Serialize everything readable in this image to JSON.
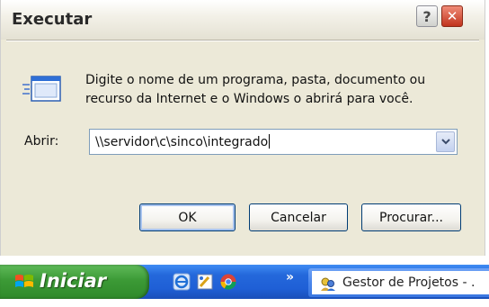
{
  "dialog": {
    "title": "Executar",
    "help_glyph": "?",
    "close_glyph": "✕",
    "description": "Digite o nome de um programa, pasta, documento ou recurso da Internet e o Windows o abrirá para você.",
    "open_label": "Abrir:",
    "open_value": "\\\\servidor\\c\\sinco\\integrado",
    "buttons": {
      "ok": "OK",
      "cancel": "Cancelar",
      "browse": "Procurar..."
    }
  },
  "taskbar": {
    "start_label": "Iniciar",
    "chevron": "»",
    "quick_launch": [
      "internet-explorer-icon",
      "paint-icon",
      "chrome-icon"
    ],
    "task_button_label": "Gestor de Projetos - ."
  },
  "colors": {
    "taskbar_blue": "#2468db",
    "start_green": "#3c9a36",
    "close_red": "#c0331d"
  }
}
